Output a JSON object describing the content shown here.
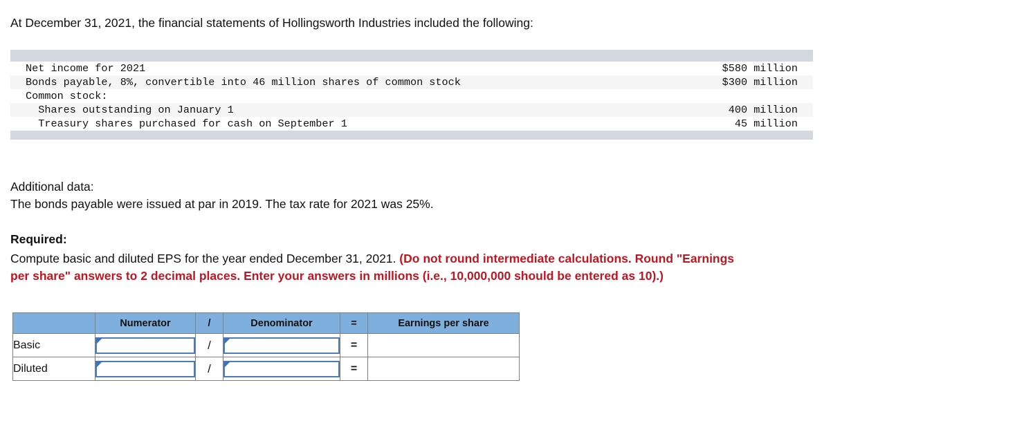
{
  "intro": "At December 31, 2021, the financial statements of Hollingsworth Industries included the following:",
  "facts_table": {
    "rows": [
      {
        "label": "Net income for 2021",
        "value": "$580 million"
      },
      {
        "label": "Bonds payable, 8%, convertible into 46 million shares of common stock",
        "value": "$300 million"
      },
      {
        "label": "Common stock:",
        "value": ""
      },
      {
        "label": "  Shares outstanding on January 1",
        "value": "400 million"
      },
      {
        "label": "  Treasury shares purchased for cash on September 1",
        "value": "45 million"
      }
    ]
  },
  "additional": {
    "heading": "Additional data:",
    "line": "The bonds payable were issued at par in 2019. The tax rate for 2021 was 25%."
  },
  "required": {
    "heading": "Required:",
    "body_black": "Compute basic and diluted EPS for the year ended December 31, 2021. ",
    "body_red_line1": "(Do not round intermediate calculations. Round \"Earnings",
    "body_red_line2": "per share\" answers to 2 decimal places. Enter your answers in millions (i.e., 10,000,000 should be entered as 10).)"
  },
  "answer_table": {
    "headers": {
      "row_label": "",
      "numerator": "Numerator",
      "slash": "/",
      "denominator": "Denominator",
      "equals": "=",
      "eps": "Earnings per share"
    },
    "rows": [
      {
        "label": "Basic",
        "numerator_value": "",
        "slash": "/",
        "denominator_value": "",
        "equals": "=",
        "eps_value": ""
      },
      {
        "label": "Diluted",
        "numerator_value": "",
        "slash": "/",
        "denominator_value": "",
        "equals": "=",
        "eps_value": ""
      }
    ]
  },
  "colors": {
    "header_blue": "#7fb0dd",
    "facts_bar_gray": "#d3d8e0",
    "alt_row_gray": "#f5f5f5",
    "red_emphasis": "#bf1722",
    "input_border_blue": "#4a7ebb",
    "input_triangle_blue": "#3c74b4",
    "table_border_gray": "#7f7f7f"
  }
}
